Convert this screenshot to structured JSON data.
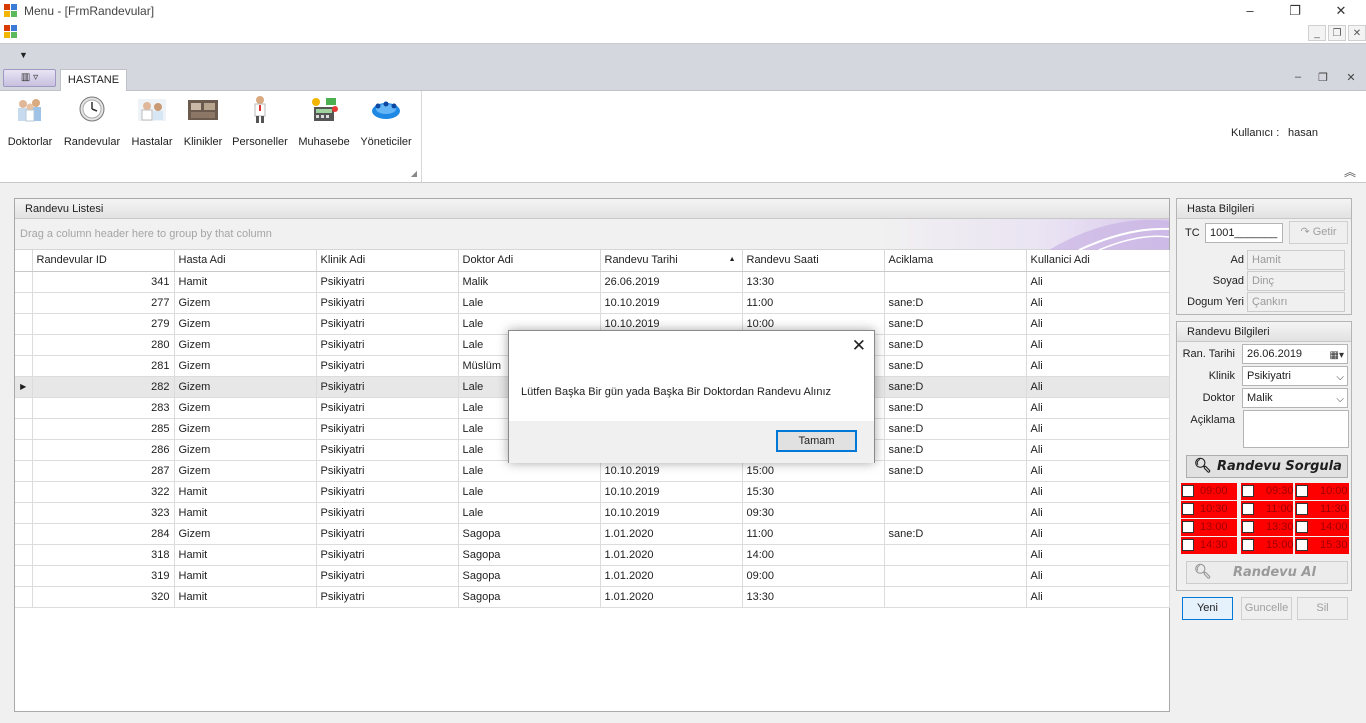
{
  "window": {
    "title": "Menu - [FrmRandevular]",
    "minimize": "–",
    "restore": "❐",
    "close": "✕"
  },
  "mdi": {
    "minimize": "_",
    "restore": "❐",
    "close": "✕"
  },
  "ribbon": {
    "tab": "HASTANE",
    "items": [
      {
        "label": "Doktorlar",
        "icon": "doctors-icon"
      },
      {
        "label": "Randevular",
        "icon": "clock-icon"
      },
      {
        "label": "Hastalar",
        "icon": "patients-icon"
      },
      {
        "label": "Klinikler",
        "icon": "clinic-icon"
      },
      {
        "label": "Personeller",
        "icon": "staff-icon"
      },
      {
        "label": "Muhasebe",
        "icon": "accounting-icon"
      },
      {
        "label": "Yöneticiler",
        "icon": "managers-icon"
      }
    ],
    "user_label": "Kullanıcı :",
    "user_value": "hasan"
  },
  "grid": {
    "title": "Randevu Listesi",
    "group_hint": "Drag a column header here to group by that column",
    "columns": [
      "Randevular ID",
      "Hasta Adi",
      "Klinik Adi",
      "Doktor Adi",
      "Randevu Tarihi",
      "Randevu Saati",
      "Aciklama",
      "Kullanici Adi"
    ],
    "rows": [
      [
        "341",
        "Hamit",
        "Psikiyatri",
        "Malik",
        "26.06.2019",
        "13:30",
        "",
        "Ali"
      ],
      [
        "277",
        "Gizem",
        "Psikiyatri",
        "Lale",
        "10.10.2019",
        "11:00",
        "sane:D",
        "Ali"
      ],
      [
        "279",
        "Gizem",
        "Psikiyatri",
        "Lale",
        "10.10.2019",
        "10:00",
        "sane:D",
        "Ali"
      ],
      [
        "280",
        "Gizem",
        "Psikiyatri",
        "Lale",
        "",
        "",
        "sane:D",
        "Ali"
      ],
      [
        "281",
        "Gizem",
        "Psikiyatri",
        "Müslüm",
        "",
        "",
        "sane:D",
        "Ali"
      ],
      [
        "282",
        "Gizem",
        "Psikiyatri",
        "Lale",
        "",
        "",
        "sane:D",
        "Ali"
      ],
      [
        "283",
        "Gizem",
        "Psikiyatri",
        "Lale",
        "",
        "",
        "sane:D",
        "Ali"
      ],
      [
        "285",
        "Gizem",
        "Psikiyatri",
        "Lale",
        "",
        "",
        "sane:D",
        "Ali"
      ],
      [
        "286",
        "Gizem",
        "Psikiyatri",
        "Lale",
        "",
        "",
        "sane:D",
        "Ali"
      ],
      [
        "287",
        "Gizem",
        "Psikiyatri",
        "Lale",
        "10.10.2019",
        "15:00",
        "sane:D",
        "Ali"
      ],
      [
        "322",
        "Hamit",
        "Psikiyatri",
        "Lale",
        "10.10.2019",
        "15:30",
        "",
        "Ali"
      ],
      [
        "323",
        "Hamit",
        "Psikiyatri",
        "Lale",
        "10.10.2019",
        "09:30",
        "",
        "Ali"
      ],
      [
        "284",
        "Gizem",
        "Psikiyatri",
        "Sagopa",
        "1.01.2020",
        "11:00",
        "sane:D",
        "Ali"
      ],
      [
        "318",
        "Hamit",
        "Psikiyatri",
        "Sagopa",
        "1.01.2020",
        "14:00",
        "",
        "Ali"
      ],
      [
        "319",
        "Hamit",
        "Psikiyatri",
        "Sagopa",
        "1.01.2020",
        "09:00",
        "",
        "Ali"
      ],
      [
        "320",
        "Hamit",
        "Psikiyatri",
        "Sagopa",
        "1.01.2020",
        "13:30",
        "",
        "Ali"
      ]
    ],
    "selected_row_index": 5
  },
  "hasta": {
    "title": "Hasta Bilgileri",
    "tc_label": "TC",
    "tc_value": "1001_______",
    "getir": "Getir",
    "ad_label": "Ad",
    "ad_value": "Hamit",
    "soyad_label": "Soyad",
    "soyad_value": "Dinç",
    "dogum_label": "Dogum Yeri",
    "dogum_value": "Çankırı"
  },
  "randevu": {
    "title": "Randevu Bilgileri",
    "tarih_label": "Ran. Tarihi",
    "tarih_value": "26.06.2019",
    "klinik_label": "Klinik",
    "klinik_value": "Psikiyatri",
    "doktor_label": "Doktor",
    "doktor_value": "Malik",
    "aciklama_label": "Açiklama",
    "sorgula": "Randevu Sorgula",
    "al": "Randevu Al",
    "slots": [
      "09:00",
      "09:30",
      "10:00",
      "10:30",
      "11:00",
      "11:30",
      "13:00",
      "13:30",
      "14:00",
      "14:30",
      "15:00",
      "15:30"
    ],
    "slot_color": "#ff0000"
  },
  "actions": {
    "yeni": "Yeni",
    "guncelle": "Guncelle",
    "sil": "Sil"
  },
  "dialog": {
    "message": "Lütfen Başka Bir gün yada Başka Bir Doktordan Randevu Alınız",
    "ok": "Tamam"
  }
}
